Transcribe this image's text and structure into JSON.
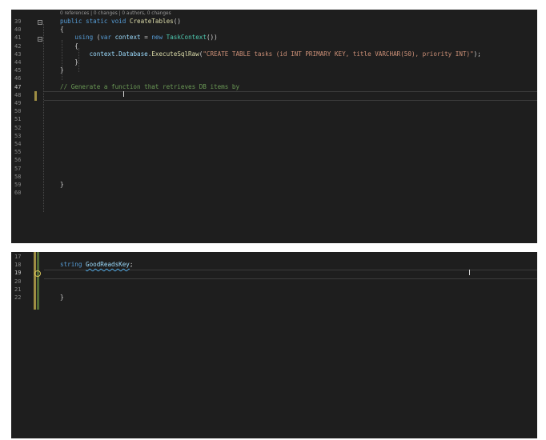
{
  "top_editor": {
    "codelens": "0 references | 0 changes | 0 authors, 0 changes",
    "lines": [
      {
        "n": "39",
        "parts": [
          [
            "kw",
            "public static void "
          ],
          [
            "fn",
            "CreateTables"
          ],
          [
            "p",
            "()"
          ]
        ]
      },
      {
        "n": "40",
        "parts": [
          [
            "p",
            "{"
          ]
        ]
      },
      {
        "n": "41",
        "parts": [
          [
            "p",
            "    "
          ],
          [
            "kw",
            "using"
          ],
          [
            "p",
            " ("
          ],
          [
            "kw",
            "var"
          ],
          [
            "p",
            " "
          ],
          [
            "vr",
            "context"
          ],
          [
            "p",
            " = "
          ],
          [
            "kw",
            "new"
          ],
          [
            "p",
            " "
          ],
          [
            "tp",
            "TaskContext"
          ],
          [
            "p",
            "())"
          ]
        ]
      },
      {
        "n": "42",
        "parts": [
          [
            "p",
            "    {"
          ]
        ]
      },
      {
        "n": "43",
        "parts": [
          [
            "p",
            "        "
          ],
          [
            "vr",
            "context"
          ],
          [
            "p",
            "."
          ],
          [
            "vr",
            "Database"
          ],
          [
            "p",
            "."
          ],
          [
            "fn",
            "ExecuteSqlRaw"
          ],
          [
            "p",
            "("
          ],
          [
            "st",
            "\"CREATE TABLE tasks (id INT PRIMARY KEY, title VARCHAR(50), priority INT)\""
          ],
          [
            "p",
            ");"
          ]
        ]
      },
      {
        "n": "44",
        "parts": [
          [
            "p",
            "    }"
          ]
        ]
      },
      {
        "n": "45",
        "parts": [
          [
            "p",
            "}"
          ]
        ]
      },
      {
        "n": "46",
        "parts": []
      },
      {
        "n": "47",
        "parts": [
          [
            "cm",
            "// Generate a function that retrieves DB items by"
          ]
        ]
      },
      {
        "n": "48",
        "parts": []
      },
      {
        "n": "49",
        "parts": []
      },
      {
        "n": "50",
        "parts": []
      },
      {
        "n": "51",
        "parts": []
      },
      {
        "n": "52",
        "parts": []
      },
      {
        "n": "53",
        "parts": []
      },
      {
        "n": "54",
        "parts": []
      },
      {
        "n": "55",
        "parts": []
      },
      {
        "n": "56",
        "parts": []
      },
      {
        "n": "57",
        "parts": []
      },
      {
        "n": "58",
        "parts": []
      },
      {
        "n": "59",
        "parts": [
          [
            "p",
            "}"
          ]
        ]
      },
      {
        "n": "60",
        "parts": []
      }
    ],
    "active_line": "47"
  },
  "bottom_editor": {
    "lines": [
      {
        "n": "17",
        "parts": []
      },
      {
        "n": "18",
        "parts": [
          [
            "kw",
            "string"
          ],
          [
            "p",
            " "
          ],
          [
            "sq",
            "GoodReadsKey"
          ],
          [
            "p",
            ";"
          ]
        ]
      },
      {
        "n": "19",
        "parts": []
      },
      {
        "n": "20",
        "parts": []
      },
      {
        "n": "21",
        "parts": []
      },
      {
        "n": "22",
        "parts": [
          [
            "p",
            "}"
          ]
        ]
      }
    ],
    "active_line": "19"
  },
  "colors": {
    "background": "#1e1e1e",
    "keyword": "#569cd6",
    "type": "#4ec9b0",
    "method": "#dcdcaa",
    "string": "#ce9178",
    "comment": "#6a9955"
  },
  "icons": [
    "lightbulb-icon",
    "text-cursor-icon",
    "fold-toggle-icon"
  ]
}
